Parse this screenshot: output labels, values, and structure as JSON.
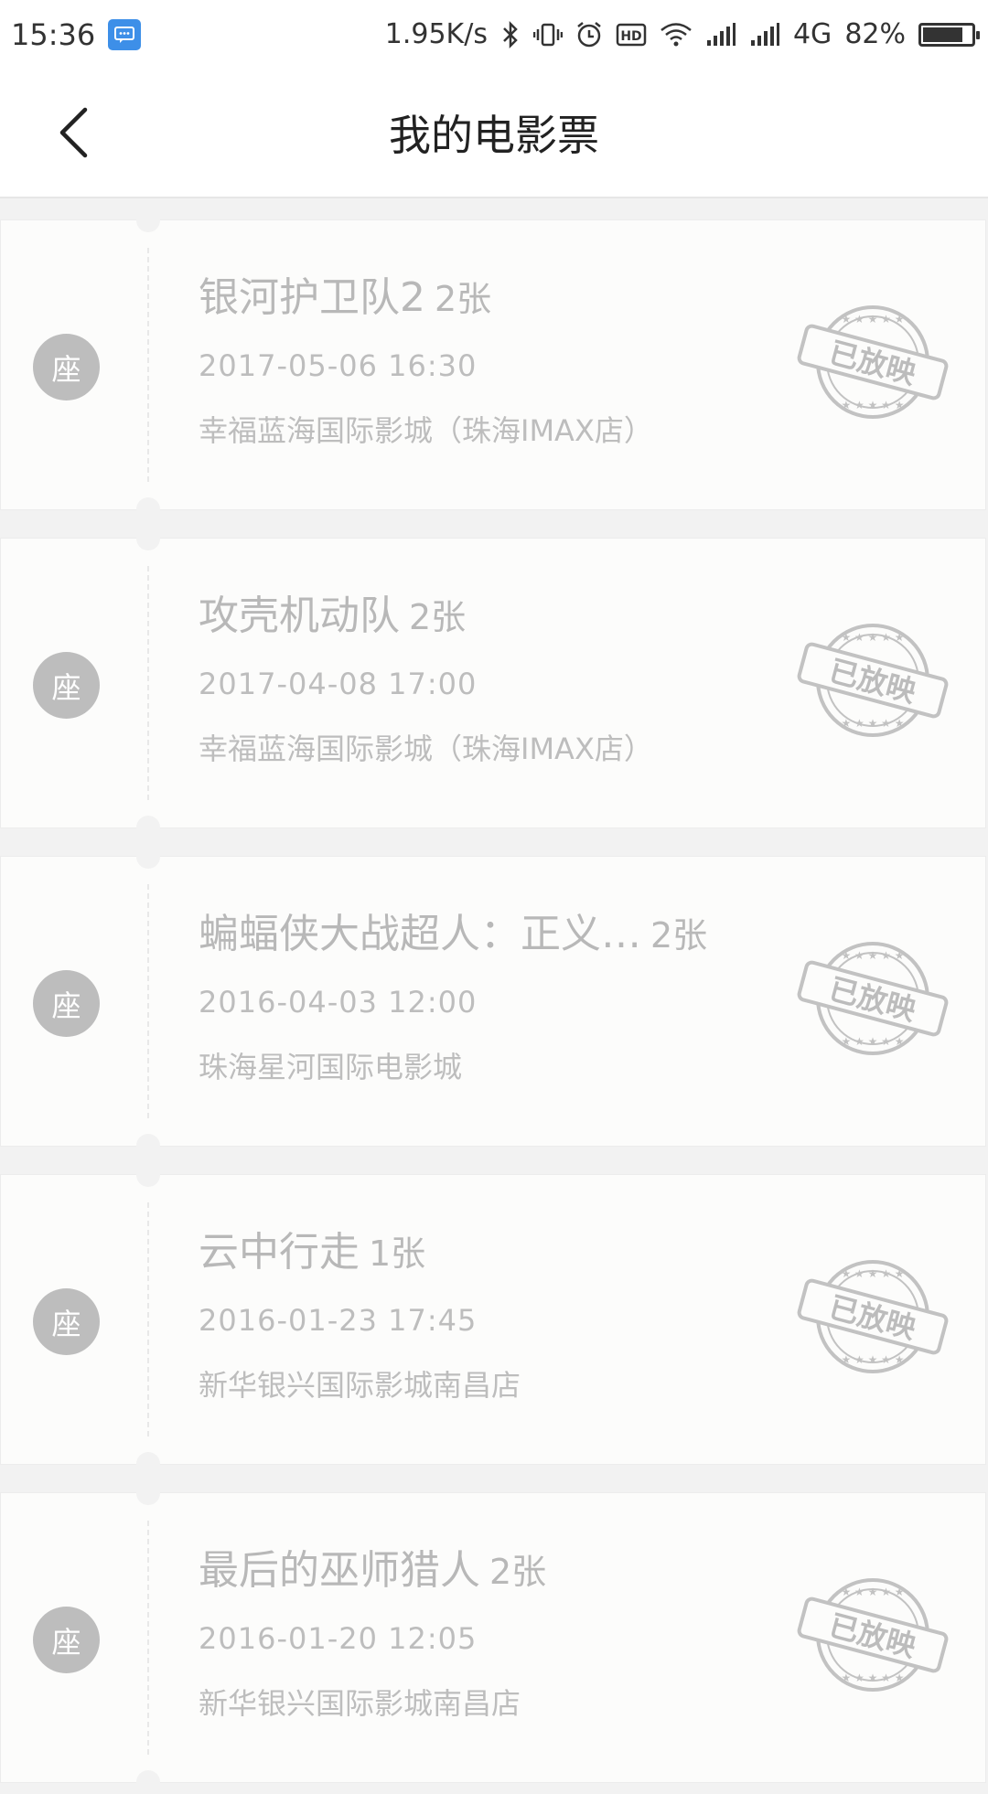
{
  "status_bar": {
    "time": "15:36",
    "net_speed": "1.95K/s",
    "network": "4G",
    "battery": "82%",
    "battery_level": 0.82,
    "icons": [
      "message-icon",
      "bluetooth-icon",
      "vibrate-icon",
      "alarm-icon",
      "hd-icon",
      "wifi-icon",
      "signal-icon",
      "signal-icon",
      "battery-icon"
    ]
  },
  "header": {
    "title": "我的电影票",
    "back_icon": "chevron-left-icon"
  },
  "tickets": [
    {
      "seat": "座",
      "title": "银河护卫队2",
      "count": "2张",
      "datetime": "2017-05-06 16:30",
      "cinema": "幸福蓝海国际影城（珠海IMAX店）",
      "stamp": "已放映"
    },
    {
      "seat": "座",
      "title": "攻壳机动队",
      "count": "2张",
      "datetime": "2017-04-08 17:00",
      "cinema": "幸福蓝海国际影城（珠海IMAX店）",
      "stamp": "已放映"
    },
    {
      "seat": "座",
      "title": "蝙蝠侠大战超人：正义…",
      "count": "2张",
      "datetime": "2016-04-03 12:00",
      "cinema": "珠海星河国际电影城",
      "stamp": "已放映"
    },
    {
      "seat": "座",
      "title": "云中行走",
      "count": "1张",
      "datetime": "2016-01-23 17:45",
      "cinema": "新华银兴国际影城南昌店",
      "stamp": "已放映"
    },
    {
      "seat": "座",
      "title": "最后的巫师猎人",
      "count": "2张",
      "datetime": "2016-01-20 12:05",
      "cinema": "新华银兴国际影城南昌店",
      "stamp": "已放映"
    }
  ]
}
